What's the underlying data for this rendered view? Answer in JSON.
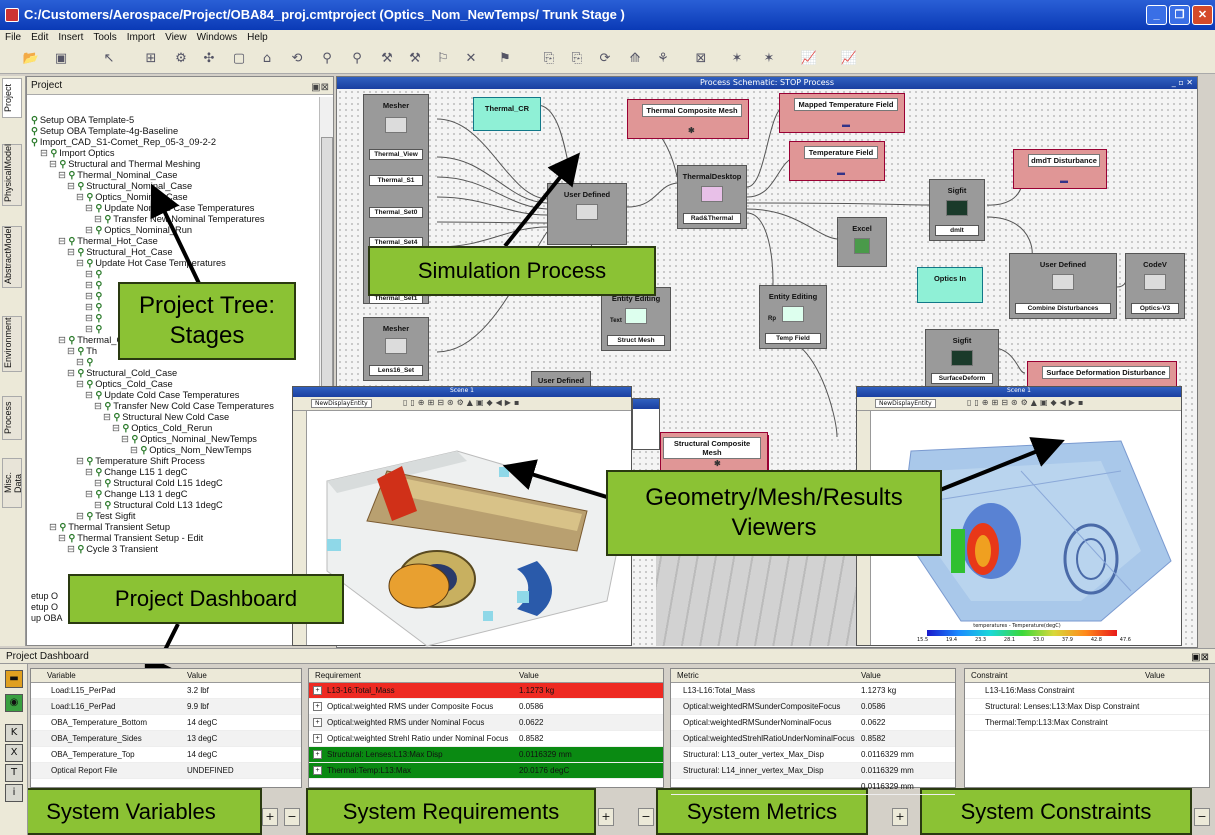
{
  "window": {
    "title": "C:/Customers/Aerospace/Project/OBA84_proj.cmtproject (Optics_Nom_NewTemps/ Trunk Stage )"
  },
  "menu": [
    "File",
    "Edit",
    "Insert",
    "Tools",
    "Import",
    "View",
    "Windows",
    "Help"
  ],
  "side_tabs": [
    "Project",
    "PhysicalModel",
    "AbstractModel",
    "Environment",
    "Process",
    "Misc. Data"
  ],
  "project_panel": {
    "title": "Project"
  },
  "tree": [
    {
      "d": 0,
      "t": "Setup OBA Template-5"
    },
    {
      "d": 0,
      "t": "Setup OBA Template-4g-Baseline"
    },
    {
      "d": 0,
      "t": "Import_CAD_S1-Comet_Rep_05-3_09-2-2"
    },
    {
      "d": 1,
      "t": "Import Optics"
    },
    {
      "d": 2,
      "t": "Structural and Thermal Meshing"
    },
    {
      "d": 3,
      "t": "Thermal_Nominal_Case"
    },
    {
      "d": 4,
      "t": "Structural_Nominal_Case"
    },
    {
      "d": 5,
      "t": "Optics_Nominal_Case"
    },
    {
      "d": 6,
      "t": "Update Nominal Case Temperatures"
    },
    {
      "d": 7,
      "t": "Transfer New Nominal Temperatures"
    },
    {
      "d": 6,
      "t": "Optics_Nominal_Run"
    },
    {
      "d": 3,
      "t": "Thermal_Hot_Case"
    },
    {
      "d": 4,
      "t": "Structural_Hot_Case"
    },
    {
      "d": 5,
      "t": "Update Hot Case Temperatures"
    },
    {
      "d": 6,
      "t": ""
    },
    {
      "d": 6,
      "t": ""
    },
    {
      "d": 6,
      "t": ""
    },
    {
      "d": 6,
      "t": ""
    },
    {
      "d": 6,
      "t": ""
    },
    {
      "d": 6,
      "t": ""
    },
    {
      "d": 3,
      "t": "Thermal_Cold_Case"
    },
    {
      "d": 4,
      "t": "Th"
    },
    {
      "d": 5,
      "t": ""
    },
    {
      "d": 4,
      "t": "Structural_Cold_Case"
    },
    {
      "d": 5,
      "t": "Optics_Cold_Case"
    },
    {
      "d": 6,
      "t": "Update Cold Case Temperatures"
    },
    {
      "d": 7,
      "t": "Transfer New Cold Case Temperatures"
    },
    {
      "d": 8,
      "t": "Structural New Cold Case"
    },
    {
      "d": 9,
      "t": "Optics_Cold_Rerun"
    },
    {
      "d": 10,
      "t": "Optics_Nominal_NewTemps"
    },
    {
      "d": 11,
      "t": "Optics_Nom_NewTemps"
    },
    {
      "d": 5,
      "t": "Temperature Shift Process"
    },
    {
      "d": 6,
      "t": "Change L15 1 degC"
    },
    {
      "d": 7,
      "t": "Structural Cold L15 1degC"
    },
    {
      "d": 6,
      "t": "Change L13 1 degC"
    },
    {
      "d": 7,
      "t": "Structural Cold L13 1degC"
    },
    {
      "d": 5,
      "t": "Test Sigfit"
    },
    {
      "d": 2,
      "t": "Thermal Transient Setup"
    },
    {
      "d": 3,
      "t": "Thermal Transient Setup - Edit"
    },
    {
      "d": 4,
      "t": "Cycle 3 Transient"
    }
  ],
  "tree_partial": [
    "etup O",
    "etup O",
    "up OBA"
  ],
  "schematic": {
    "title": "Process Schematic: STOP Process",
    "nodes": {
      "mesher1": {
        "title": "Mesher",
        "subs": [
          "Thermal_View",
          "Thermal_S1",
          "Thermal_Set0",
          "Thermal_Set4",
          "Thermal_Set1"
        ]
      },
      "mesher2": {
        "title": "Mesher",
        "sub": "Lens16_Set"
      },
      "thermal_cr": "Thermal_CR",
      "user_defined1": {
        "title": "User Defined"
      },
      "user_defined_partial": "User Defined",
      "thermal_desktop": {
        "title": "ThermalDesktop",
        "sub": "Rad&Thermal"
      },
      "entity_editing1": {
        "title": "Entity Editing",
        "sub": "Struct Mesh",
        "tag": "Text"
      },
      "entity_editing2": {
        "title": "Entity Editing",
        "sub": "Temp Field",
        "tag": "Rp"
      },
      "excel": {
        "title": "Excel"
      },
      "sigfit1": {
        "title": "Sigfit",
        "sub": "dmlt"
      },
      "sigfit2": {
        "title": "Sigfit",
        "sub": "SurfaceDeform"
      },
      "optics_in": "Optics In",
      "user_defined2": {
        "title": "User Defined",
        "sub": "Combine Disturbances"
      },
      "codev": {
        "title": "CodeV",
        "sub": "Optics-V3"
      },
      "thermal_composite_mesh": "Thermal Composite Mesh",
      "mapped_temperature_field": "Mapped Temperature Field",
      "temperature_field": "Temperature Field",
      "dmdt_disturbance": "dmdT Disturbance",
      "surface_deformation_disturbance": "Surface Deformation Disturbance",
      "structural_composite_mesh": "Structural Composite Mesh"
    }
  },
  "viewer1": {
    "title": "Scene 1",
    "dropdown": "NewDisplayEntity"
  },
  "viewer2": {
    "title": "Scene 1",
    "dropdown": "NewDisplayEntity",
    "legend_title": "temperatures - Temperature(degC)",
    "legend_ticks": [
      "15.5",
      "19.4",
      "23.3",
      "28.1",
      "33.0",
      "37.9",
      "42.8",
      "47.6"
    ]
  },
  "callouts": {
    "project_tree": "Project Tree:\nStages",
    "simulation_process": "Simulation Process",
    "viewers": "Geometry/Mesh/Results\nViewers",
    "project_dashboard": "Project Dashboard",
    "system_variables": "System Variables",
    "system_requirements": "System Requirements",
    "system_metrics": "System Metrics",
    "system_constraints": "System Constraints"
  },
  "dashboard": {
    "title": "Project Dashboard",
    "variables": {
      "headers": [
        "Variable",
        "Value"
      ],
      "rows": [
        [
          "Load:L15_PerPad",
          "3.2 lbf"
        ],
        [
          "Load:L16_PerPad",
          "9.9 lbf"
        ],
        [
          "OBA_Temperature_Bottom",
          "14 degC"
        ],
        [
          "OBA_Temperature_Sides",
          "13 degC"
        ],
        [
          "OBA_Temperature_Top",
          "14 degC"
        ],
        [
          "Optical Report File",
          "UNDEFINED"
        ]
      ]
    },
    "requirements": {
      "headers": [
        "Requirement",
        "Value"
      ],
      "rows": [
        [
          "L13-16:Total_Mass",
          "1.1273 kg",
          "red"
        ],
        [
          "Optical:weighted RMS under Composite Focus",
          "0.0586",
          ""
        ],
        [
          "Optical:weighted RMS under Nominal Focus",
          "0.0622",
          ""
        ],
        [
          "Optical:weighted Strehl Ratio under Nominal Focus",
          "0.8582",
          ""
        ],
        [
          "Structural: Lenses:L13:Max Disp",
          "0.0116329 mm",
          "green"
        ],
        [
          "Thermal:Temp:L13:Max",
          "20.0176 degC",
          "green"
        ]
      ]
    },
    "metrics": {
      "headers": [
        "Metric",
        "Value"
      ],
      "rows": [
        [
          "L13-L16:Total_Mass",
          "1.1273 kg"
        ],
        [
          "Optical:weightedRMSunderCompositeFocus",
          "0.0586"
        ],
        [
          "Optical:weightedRMSunderNominalFocus",
          "0.0622"
        ],
        [
          "Optical:weightedStrehlRatioUnderNominalFocus",
          "0.8582"
        ],
        [
          "Structural: L13_outer_vertex_Max_Disp",
          "0.0116329 mm"
        ],
        [
          "Structural: L14_inner_vertex_Max_Disp",
          "0.0116329 mm"
        ],
        [
          "",
          "0.0116329 mm"
        ]
      ]
    },
    "constraints": {
      "headers": [
        "Constraint",
        "Value"
      ],
      "rows": [
        [
          "L13-L16:Mass Constraint"
        ],
        [
          "Structural: Lenses:L13:Max Disp Constraint"
        ],
        [
          "Thermal:Temp:L13:Max Constraint"
        ]
      ]
    }
  }
}
